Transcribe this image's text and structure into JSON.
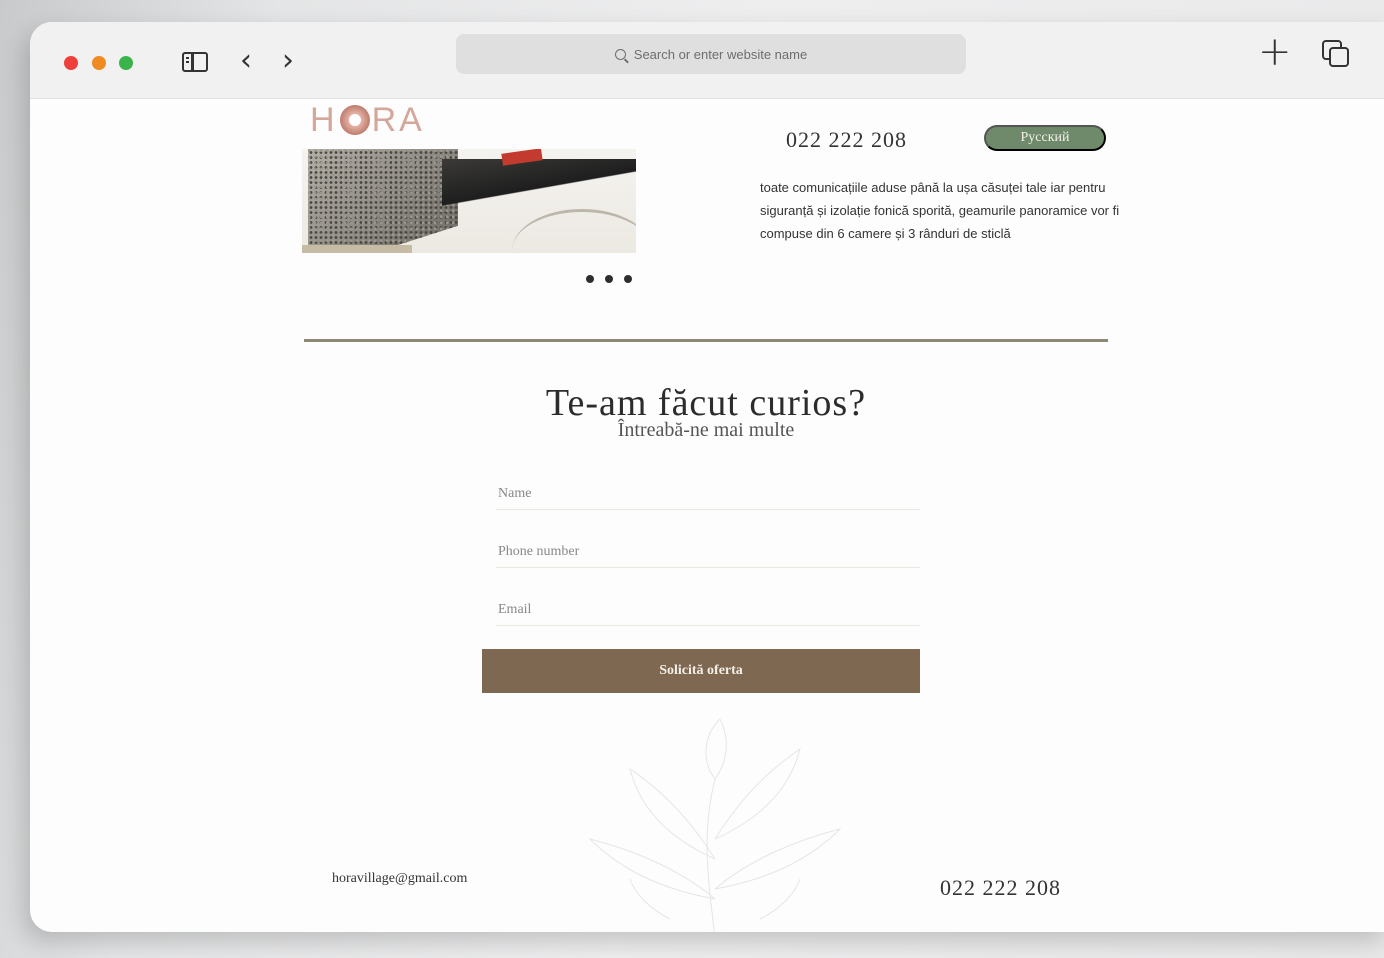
{
  "browser": {
    "address_placeholder": "Search or enter website name",
    "colors": {
      "close": "#ee3f3a",
      "minimize": "#ef8b22",
      "zoom": "#39b34a"
    }
  },
  "site": {
    "logo_text_1": "H",
    "logo_text_2": "RA",
    "phone": "022 222 208",
    "language_button": "Русский",
    "description": "toate comunicațiile aduse până la ușa căsuței tale iar pentru siguranță și izolație fonică sporită, geamurile panoramice vor fi compuse din 6 camere și 3 rânduri de sticlă",
    "colors": {
      "accent_green": "#6f8a6a",
      "accent_brown": "#7f6851",
      "logo": "#d4a79b"
    }
  },
  "contact_form": {
    "heading": "Te-am făcut curios?",
    "subheading": "Întreabă-ne mai multe",
    "name_placeholder": "Name",
    "phone_placeholder": "Phone number",
    "email_placeholder": "Email",
    "submit_label": "Solicită oferta"
  },
  "footer": {
    "email": "horavillage@gmail.com",
    "phone": "022 222 208"
  }
}
